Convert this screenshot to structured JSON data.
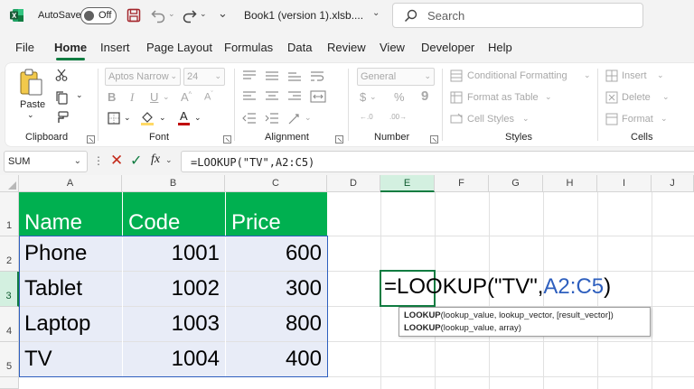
{
  "titlebar": {
    "autosave_label": "AutoSave",
    "autosave_state": "Off",
    "document_title": "Book1 (version 1).xlsb....",
    "search_placeholder": "Search"
  },
  "menu": {
    "tabs": [
      "File",
      "Home",
      "Insert",
      "Page Layout",
      "Formulas",
      "Data",
      "Review",
      "View",
      "Developer",
      "Help"
    ],
    "active": "Home"
  },
  "ribbon": {
    "clipboard": {
      "label": "Clipboard",
      "paste": "Paste"
    },
    "font": {
      "label": "Font",
      "font_name": "Aptos Narrow",
      "font_size": "24"
    },
    "alignment": {
      "label": "Alignment"
    },
    "number": {
      "label": "Number",
      "format": "General"
    },
    "styles": {
      "label": "Styles",
      "conditional_formatting": "Conditional Formatting",
      "format_as_table": "Format as Table",
      "cell_styles": "Cell Styles"
    },
    "cells": {
      "label": "Cells",
      "insert": "Insert",
      "delete": "Delete",
      "format": "Format"
    }
  },
  "formula_bar": {
    "name_box": "SUM",
    "formula": "=LOOKUP(\"TV\",A2:C5)"
  },
  "grid": {
    "columns": [
      "A",
      "B",
      "C",
      "D",
      "E",
      "F",
      "G",
      "H",
      "I",
      "J"
    ],
    "rows": [
      "1",
      "2",
      "3",
      "4",
      "5"
    ],
    "selected_column": "E",
    "selected_row": "3",
    "table": {
      "headers": [
        "Name",
        "Code",
        "Price"
      ],
      "rows": [
        [
          "Phone",
          "1001",
          "600"
        ],
        [
          "Tablet",
          "1002",
          "300"
        ],
        [
          "Laptop",
          "1003",
          "800"
        ],
        [
          "TV",
          "1004",
          "400"
        ]
      ]
    },
    "editing_formula_prefix": "=LOOKUP(\"TV\",",
    "editing_formula_ref": "A2:C5",
    "editing_formula_suffix": ")"
  },
  "tooltip": {
    "line1_fn": "LOOKUP",
    "line1_args": "(lookup_value, lookup_vector, [result_vector])",
    "line2_fn": "LOOKUP",
    "line2_args": "(lookup_value, array)"
  },
  "colors": {
    "excel_green": "#107c41",
    "header_fill": "#00b050",
    "body_fill": "#e8ecf7",
    "ref_blue": "#2e5fbe"
  }
}
